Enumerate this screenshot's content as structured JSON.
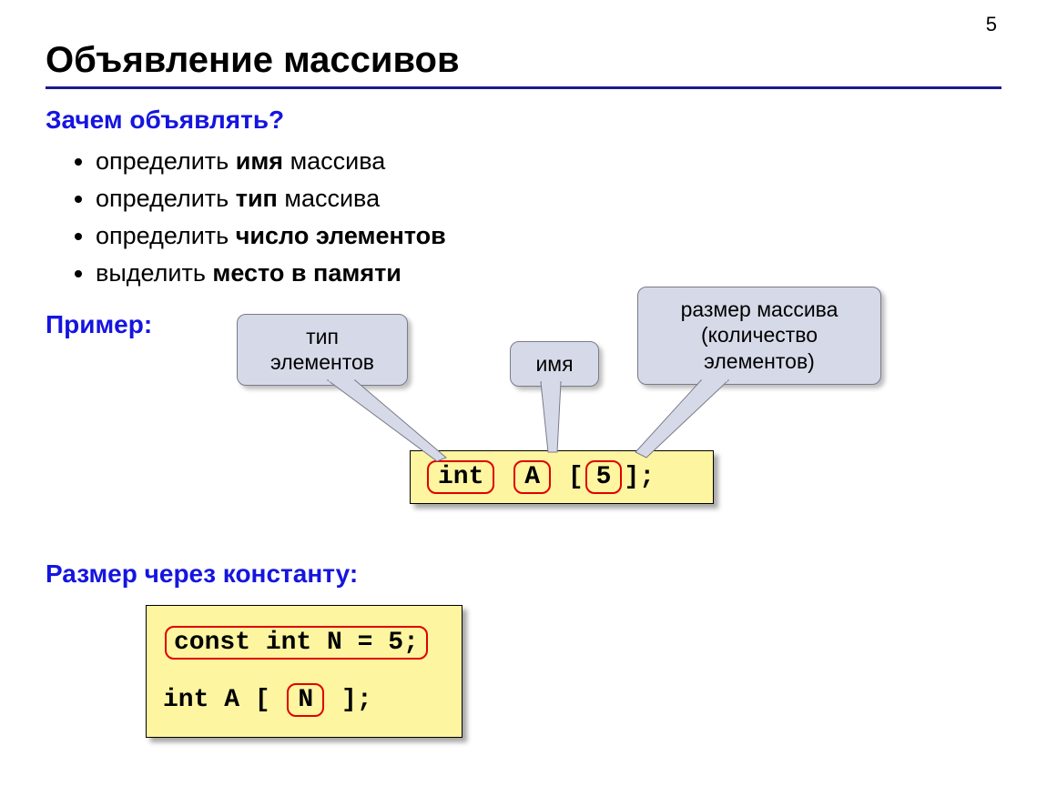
{
  "page_number": "5",
  "title": "Объявление массивов",
  "why_heading": "Зачем объявлять?",
  "bullets": {
    "b0a": "определить ",
    "b0b": "имя",
    "b0c": " массива",
    "b1a": "определить ",
    "b1b": "тип",
    "b1c": " массива",
    "b2a": "определить ",
    "b2b": "число элементов",
    "b2c": "",
    "b3a": "выделить ",
    "b3b": "место в памяти",
    "b3c": ""
  },
  "example_heading": "Пример:",
  "callouts": {
    "type_line1": "тип",
    "type_line2": "элементов",
    "name": "имя",
    "size_line1": "размер массива",
    "size_line2": "(количество",
    "size_line3": "элементов)"
  },
  "example_code": {
    "kw_int": "int",
    "sp1": "  ",
    "name_A": "A",
    "sp2": " [",
    "size_5": " 5 ",
    "tail": "];"
  },
  "const_heading": "Размер через константу:",
  "const_code": {
    "line1": "const int N = 5;",
    "line2_a": "int  A [ ",
    "line2_b": "N",
    "line2_c": " ];"
  }
}
